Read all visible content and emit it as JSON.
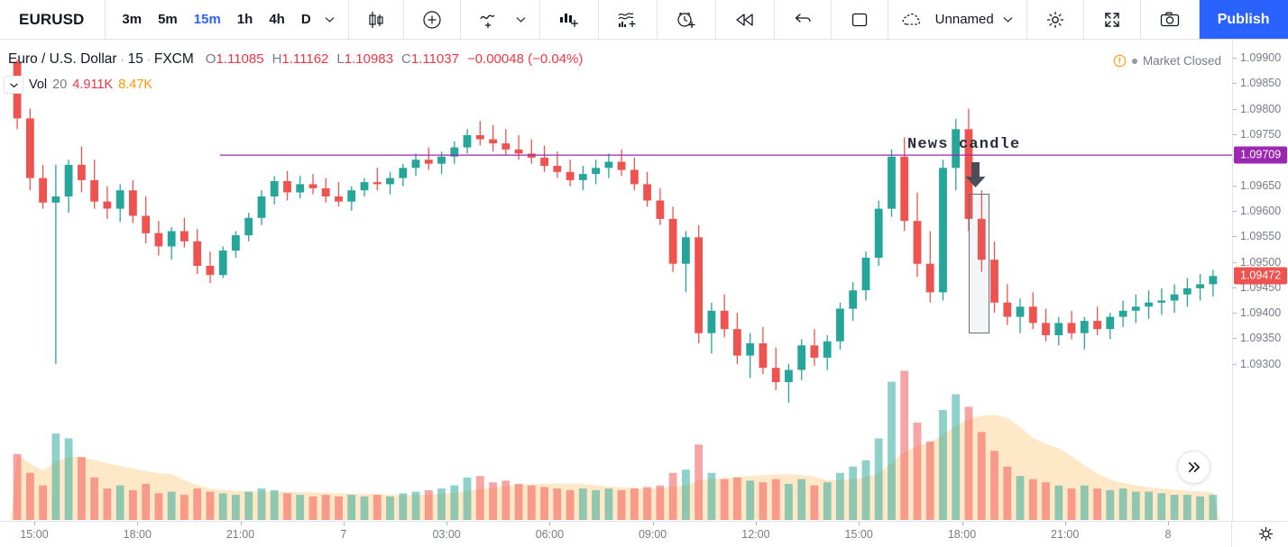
{
  "toolbar": {
    "symbol": "EURUSD",
    "timeframes": [
      {
        "label": "3m",
        "active": false
      },
      {
        "label": "5m",
        "active": false
      },
      {
        "label": "15m",
        "active": true
      },
      {
        "label": "1h",
        "active": false
      },
      {
        "label": "4h",
        "active": false
      },
      {
        "label": "D",
        "active": false
      }
    ],
    "chart_type_icon": "candlestick-icon",
    "compare_icon": "plus-circle-icon",
    "indicators_icon": "indicators-icon",
    "templates_icon": "indicator-templates-icon",
    "alerts_icon": "alarm-clock-icon",
    "replay_icon": "bar-replay-icon",
    "undo_icon": "undo-icon",
    "layout_icon": "layout-square-icon",
    "layout_name": "Unnamed",
    "settings_icon": "gear-icon",
    "fullscreen_icon": "fullscreen-icon",
    "snapshot_icon": "camera-icon",
    "publish_label": "Publish",
    "play_icon": "play-circle-icon"
  },
  "legend": {
    "title": "Euro / U.S. Dollar",
    "interval": "15",
    "exchange": "FXCM",
    "sep": "·",
    "ohlc": [
      {
        "key": "O",
        "value": "1.11085"
      },
      {
        "key": "H",
        "value": "1.11162"
      },
      {
        "key": "L",
        "value": "1.10983"
      },
      {
        "key": "C",
        "value": "1.11037"
      }
    ],
    "change": "−0.00048 (−0.04%)",
    "volume_label": "Vol",
    "volume_length": "20",
    "volume_value": "4.911K",
    "volume_ma": "8.47K",
    "collapse_icon": "chevron-down-icon",
    "market_status": "Market Closed",
    "market_icon": "warning-circle-icon"
  },
  "annotation": {
    "news_label": "News candle",
    "arrow_icon": "down-arrow-icon"
  },
  "scroll_to_realtime_icon": "double-chevron-right-icon",
  "time_axis_settings_icon": "gear-icon",
  "colors": {
    "accent": "#2962ff",
    "up": "#26a69a",
    "down": "#ef5350",
    "price_line": "#9c27b0",
    "last_price": "#ef5350",
    "volume_ma": "#ff9800",
    "grid": "#e0e3eb",
    "text": "#131722",
    "muted": "#787b86"
  },
  "chart_data": {
    "type": "candlestick",
    "title": "Euro / U.S. Dollar · 15 · FXCM",
    "xlabel": "",
    "ylabel": "",
    "ylim": [
      1.0925,
      1.0993
    ],
    "price_ticks": [
      "1.09900",
      "1.09850",
      "1.09800",
      "1.09750",
      "1.09700",
      "1.09650",
      "1.09600",
      "1.09550",
      "1.09500",
      "1.09450",
      "1.09400",
      "1.09350",
      "1.09300"
    ],
    "time_ticks": [
      "15:00",
      "18:00",
      "21:00",
      "7",
      "03:00",
      "06:00",
      "09:00",
      "12:00",
      "15:00",
      "18:00",
      "21:00",
      "8"
    ],
    "horizontal_line": {
      "value": "1.09709",
      "color": "#9c27b0"
    },
    "last_price": {
      "value": "1.09472",
      "color": "#ef5350"
    },
    "ohlc_header": {
      "open": "1.11085",
      "high": "1.11162",
      "low": "1.10983",
      "close": "1.11037",
      "change": "−0.00048",
      "change_pct": "−0.04%"
    },
    "volume_pane": {
      "label": "Vol 20",
      "value": "4.911K",
      "ma": "8.47K",
      "ma_color": "#ff9800"
    },
    "candles": [
      [
        1.09891,
        1.09896,
        1.0976,
        1.09781,
        0.42
      ],
      [
        1.09781,
        1.098,
        1.0964,
        1.09664,
        0.3
      ],
      [
        1.09664,
        1.0969,
        1.09604,
        1.09616,
        0.22
      ],
      [
        1.09616,
        1.0969,
        1.093,
        1.09628,
        0.55
      ],
      [
        1.09628,
        1.097,
        1.09596,
        1.0969,
        0.52
      ],
      [
        1.0969,
        1.09726,
        1.09636,
        1.0966,
        0.4
      ],
      [
        1.0966,
        1.097,
        1.09604,
        1.09618,
        0.27
      ],
      [
        1.09618,
        1.09648,
        1.09584,
        1.09604,
        0.2
      ],
      [
        1.09604,
        1.09652,
        1.09578,
        1.0964,
        0.22
      ],
      [
        1.0964,
        1.0966,
        1.09576,
        1.0959,
        0.19
      ],
      [
        1.0959,
        1.09628,
        1.09536,
        1.09556,
        0.23
      ],
      [
        1.09556,
        1.0958,
        1.09512,
        1.0953,
        0.17
      ],
      [
        1.0953,
        1.09568,
        1.09504,
        1.0956,
        0.18
      ],
      [
        1.0956,
        1.09586,
        1.09528,
        1.0954,
        0.16
      ],
      [
        1.0954,
        1.09564,
        1.09476,
        1.09492,
        0.2
      ],
      [
        1.09492,
        1.0952,
        1.09458,
        1.09474,
        0.18
      ],
      [
        1.09474,
        1.0953,
        1.09468,
        1.09522,
        0.17
      ],
      [
        1.09522,
        1.0956,
        1.09508,
        1.09552,
        0.16
      ],
      [
        1.09552,
        1.09596,
        1.0954,
        1.09586,
        0.18
      ],
      [
        1.09586,
        1.0964,
        1.09572,
        1.09628,
        0.2
      ],
      [
        1.09628,
        1.09668,
        1.09612,
        1.09658,
        0.19
      ],
      [
        1.09658,
        1.09678,
        1.0962,
        1.09636,
        0.17
      ],
      [
        1.09636,
        1.09668,
        1.09624,
        1.09652,
        0.16
      ],
      [
        1.09652,
        1.09672,
        1.09632,
        1.09644,
        0.15
      ],
      [
        1.09644,
        1.09664,
        1.09616,
        1.09628,
        0.16
      ],
      [
        1.09628,
        1.09656,
        1.09608,
        1.09618,
        0.15
      ],
      [
        1.09618,
        1.09648,
        1.096,
        1.0964,
        0.16
      ],
      [
        1.0964,
        1.09664,
        1.09628,
        1.09656,
        0.15
      ],
      [
        1.09656,
        1.09684,
        1.0964,
        1.09652,
        0.16
      ],
      [
        1.09652,
        1.09676,
        1.09632,
        1.09664,
        0.15
      ],
      [
        1.09664,
        1.09692,
        1.09648,
        1.09684,
        0.17
      ],
      [
        1.09684,
        1.09712,
        1.09668,
        1.097,
        0.18
      ],
      [
        1.097,
        1.09724,
        1.0968,
        1.09692,
        0.19
      ],
      [
        1.09692,
        1.09716,
        1.09672,
        1.09706,
        0.2
      ],
      [
        1.09706,
        1.09736,
        1.09692,
        1.09724,
        0.22
      ],
      [
        1.09724,
        1.0976,
        1.09712,
        1.09748,
        0.27
      ],
      [
        1.09748,
        1.09776,
        1.09728,
        1.0974,
        0.28
      ],
      [
        1.0974,
        1.09768,
        1.09716,
        1.09732,
        0.24
      ],
      [
        1.09732,
        1.0976,
        1.09708,
        1.0972,
        0.25
      ],
      [
        1.0972,
        1.09748,
        1.097,
        1.09712,
        0.23
      ],
      [
        1.09712,
        1.0974,
        1.09692,
        1.09704,
        0.22
      ],
      [
        1.09704,
        1.09728,
        1.09676,
        1.09688,
        0.21
      ],
      [
        1.09688,
        1.09716,
        1.09664,
        1.09676,
        0.2
      ],
      [
        1.09676,
        1.097,
        1.09648,
        1.0966,
        0.19
      ],
      [
        1.0966,
        1.09688,
        1.0964,
        1.09672,
        0.2
      ],
      [
        1.09672,
        1.097,
        1.09652,
        1.09684,
        0.19
      ],
      [
        1.09684,
        1.09712,
        1.09664,
        1.09696,
        0.2
      ],
      [
        1.09696,
        1.0972,
        1.09668,
        1.0968,
        0.19
      ],
      [
        1.0968,
        1.09704,
        1.0964,
        1.09652,
        0.2
      ],
      [
        1.09652,
        1.09676,
        1.09608,
        1.0962,
        0.21
      ],
      [
        1.0962,
        1.09644,
        1.09572,
        1.09584,
        0.22
      ],
      [
        1.09584,
        1.09608,
        1.0948,
        1.09496,
        0.3
      ],
      [
        1.09496,
        1.0956,
        1.0944,
        1.09548,
        0.32
      ],
      [
        1.09548,
        1.09572,
        1.0934,
        1.0936,
        0.48
      ],
      [
        1.0936,
        1.0942,
        1.0932,
        1.09404,
        0.3
      ],
      [
        1.09404,
        1.09436,
        1.09352,
        1.09368,
        0.26
      ],
      [
        1.09368,
        1.094,
        1.093,
        1.09316,
        0.27
      ],
      [
        1.09316,
        1.0936,
        1.09272,
        1.0934,
        0.25
      ],
      [
        1.0934,
        1.09372,
        1.0928,
        1.09292,
        0.24
      ],
      [
        1.09292,
        1.09332,
        1.09248,
        1.09264,
        0.26
      ],
      [
        1.09264,
        1.093,
        1.09224,
        1.09288,
        0.23
      ],
      [
        1.09288,
        1.09348,
        1.09268,
        1.09336,
        0.26
      ],
      [
        1.09336,
        1.09368,
        1.09296,
        1.09312,
        0.22
      ],
      [
        1.09312,
        1.09356,
        1.09288,
        1.09344,
        0.24
      ],
      [
        1.09344,
        1.0942,
        1.09328,
        1.09408,
        0.3
      ],
      [
        1.09408,
        1.0946,
        1.09384,
        1.09444,
        0.34
      ],
      [
        1.09444,
        1.0952,
        1.09424,
        1.09508,
        0.38
      ],
      [
        1.09508,
        1.0962,
        1.09492,
        1.09604,
        0.52
      ],
      [
        1.09604,
        1.0972,
        1.09588,
        1.09706,
        0.88
      ],
      [
        1.09706,
        1.09744,
        1.0956,
        1.0958,
        0.95
      ],
      [
        1.0958,
        1.09636,
        1.0947,
        1.09496,
        0.62
      ],
      [
        1.09496,
        1.0956,
        1.0942,
        1.0944,
        0.5
      ],
      [
        1.0944,
        1.097,
        1.09424,
        1.09684,
        0.7
      ],
      [
        1.09684,
        1.0978,
        1.0964,
        1.0976,
        0.8
      ],
      [
        1.0976,
        1.098,
        1.0956,
        1.09584,
        0.72
      ],
      [
        1.09584,
        1.0964,
        1.0948,
        1.09504,
        0.56
      ],
      [
        1.09504,
        1.0954,
        1.094,
        1.0942,
        0.44
      ],
      [
        1.0942,
        1.09456,
        1.09376,
        1.09392,
        0.34
      ],
      [
        1.09392,
        1.09428,
        1.0936,
        1.09412,
        0.28
      ],
      [
        1.09412,
        1.0944,
        1.09368,
        1.0938,
        0.26
      ],
      [
        1.0938,
        1.09408,
        1.09344,
        1.09356,
        0.24
      ],
      [
        1.09356,
        1.09392,
        1.09336,
        1.0938,
        0.22
      ],
      [
        1.0938,
        1.09404,
        1.09348,
        1.0936,
        0.2
      ],
      [
        1.0936,
        1.09392,
        1.09328,
        1.09384,
        0.22
      ],
      [
        1.09384,
        1.09412,
        1.09356,
        1.09368,
        0.2
      ],
      [
        1.09368,
        1.094,
        1.09348,
        1.09392,
        0.19
      ],
      [
        1.09392,
        1.09424,
        1.09372,
        1.09404,
        0.2
      ],
      [
        1.09404,
        1.09436,
        1.0938,
        1.09412,
        0.18
      ],
      [
        1.09412,
        1.09444,
        1.09388,
        1.0942,
        0.18
      ],
      [
        1.0942,
        1.09448,
        1.09396,
        1.09424,
        0.17
      ],
      [
        1.09424,
        1.09456,
        1.094,
        1.09436,
        0.16
      ],
      [
        1.09436,
        1.09468,
        1.09412,
        1.09448,
        0.16
      ],
      [
        1.09448,
        1.09476,
        1.09424,
        1.09456,
        0.15
      ],
      [
        1.09456,
        1.09484,
        1.09432,
        1.09472,
        0.16
      ]
    ]
  }
}
